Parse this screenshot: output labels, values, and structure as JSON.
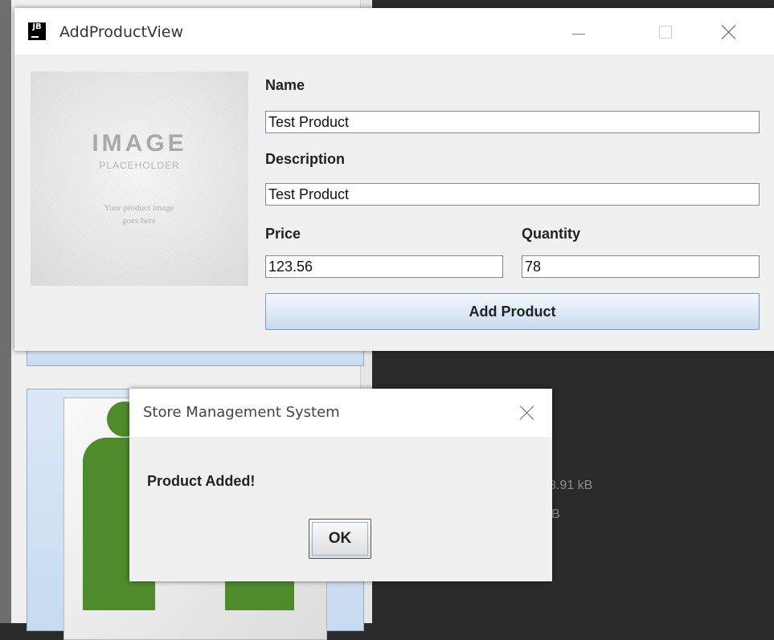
{
  "add_product_window": {
    "title": "AddProductView",
    "image_placeholder": {
      "heading": "IMAGE",
      "subheading": "PLACEHOLDER",
      "caption_line1": "Your product image",
      "caption_line2": "goes here"
    },
    "name_label": "Name",
    "name_value": "Test Product",
    "description_label": "Description",
    "description_value": "Test Product",
    "price_label": "Price",
    "price_value": "123.56",
    "quantity_label": "Quantity",
    "quantity_value": "78",
    "add_button_label": "Add Product"
  },
  "dialog": {
    "title": "Store Management System",
    "message": "Product Added!",
    "ok_label": "OK"
  },
  "background": {
    "size_text_1": "3.91 kB",
    "size_text_2": "B"
  },
  "colors": {
    "accent_green": "#4f8a2b",
    "dark_panel": "#2b2b2b",
    "button_gradient_bottom": "#c9dbee"
  }
}
